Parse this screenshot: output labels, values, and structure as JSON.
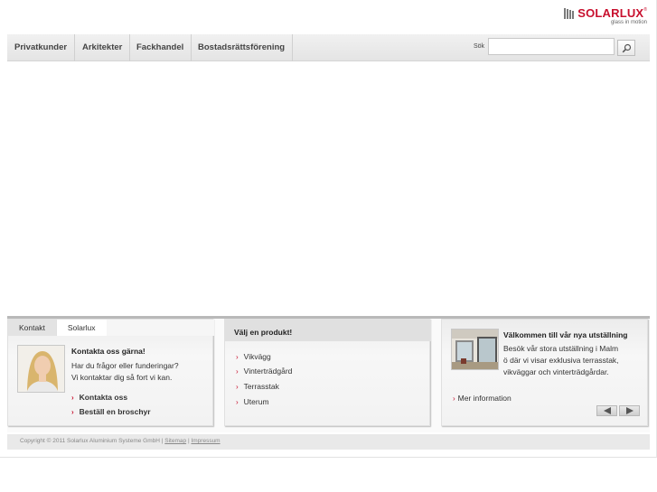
{
  "brand": {
    "name": "SOLARLUX",
    "reg": "®",
    "tagline": "glass in motion",
    "color": "#c8102e"
  },
  "nav": {
    "items": [
      {
        "label": "Privatkunder"
      },
      {
        "label": "Arkitekter"
      },
      {
        "label": "Fackhandel"
      },
      {
        "label": "Bostadsrättsförening"
      }
    ],
    "search_label": "Sök",
    "search_value": "",
    "search_icon": "magnifier-icon"
  },
  "contact_panel": {
    "tabs": [
      {
        "label": "Kontakt"
      },
      {
        "label": "Solarlux"
      }
    ],
    "title": "Kontakta oss gärna!",
    "text_line1": "Har du frågor eller funderingar?",
    "text_line2": "Vi kontaktar dig så fort vi kan.",
    "links": [
      {
        "label": "Kontakta oss"
      },
      {
        "label": "Beställ en broschyr"
      }
    ]
  },
  "product_panel": {
    "title": "Välj en produkt!",
    "links": [
      {
        "label": "Vikvägg"
      },
      {
        "label": "Vinterträdgård"
      },
      {
        "label": "Terrasstak"
      },
      {
        "label": "Uterum"
      }
    ]
  },
  "exhibition_panel": {
    "title": "Välkommen till vår nya utställning",
    "text_line1": "Besök vår stora utställning i Malm",
    "text_line2": "ö där vi visar exklusiva terrasstak,",
    "text_line3": "vikväggar och vinterträdgårdar.",
    "more_link": "Mer information",
    "pager_icons": [
      "arrow-left-icon",
      "arrow-right-icon"
    ]
  },
  "footer": {
    "copyright": "Copyright © 2011 Solarlux Aluminium Systeme GmbH |",
    "sitemap": "Sitemap",
    "separator": "|",
    "impressum": "Impressum"
  }
}
